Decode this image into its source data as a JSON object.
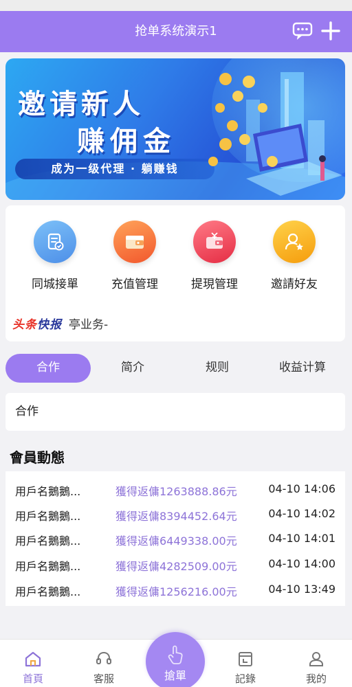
{
  "header": {
    "title": "抢单系统演示1",
    "chat_icon": "chat-bubble-icon",
    "add_icon": "plus-icon"
  },
  "banner": {
    "headline_1": "邀请新人",
    "headline_2": "赚佣金",
    "tagline": "成为一级代理 · 躺赚钱"
  },
  "menu": [
    {
      "label": "同城接單",
      "icon": "document-check-icon",
      "color": "#5aa2ee"
    },
    {
      "label": "充值管理",
      "icon": "wallet-icon",
      "color": "#f8743e"
    },
    {
      "label": "提現管理",
      "icon": "wallet-withdraw-icon",
      "color": "#ef3f55"
    },
    {
      "label": "邀請好友",
      "icon": "user-star-icon",
      "color": "#f6b61c"
    }
  ],
  "news": {
    "logo_part1": "头条",
    "logo_part2": "快报",
    "text": "亭业务-"
  },
  "tabs": [
    {
      "label": "合作",
      "active": true
    },
    {
      "label": "简介",
      "active": false
    },
    {
      "label": "规则",
      "active": false
    },
    {
      "label": "收益计算",
      "active": false
    }
  ],
  "content": {
    "text": "合作"
  },
  "activity": {
    "title": "會員動態",
    "rows": [
      {
        "user": "用戶名鵝鵝...",
        "amount": "獲得返傭1263888.86元",
        "time": "04-10 14:06"
      },
      {
        "user": "用戶名鵝鵝...",
        "amount": "獲得返傭8394452.64元",
        "time": "04-10 14:02"
      },
      {
        "user": "用戶名鵝鵝...",
        "amount": "獲得返傭6449338.00元",
        "time": "04-10 14:01"
      },
      {
        "user": "用戶名鵝鵝...",
        "amount": "獲得返傭4282509.00元",
        "time": "04-10 14:00"
      },
      {
        "user": "用戶名鵝鵝...",
        "amount": "獲得返傭1256216.00元",
        "time": "04-10 13:49"
      }
    ]
  },
  "tabbar": {
    "home": "首頁",
    "service": "客服",
    "grab": "搶單",
    "records": "記錄",
    "mine": "我的"
  },
  "colors": {
    "accent": "#9b7bf0",
    "amount": "#8d73d8"
  }
}
